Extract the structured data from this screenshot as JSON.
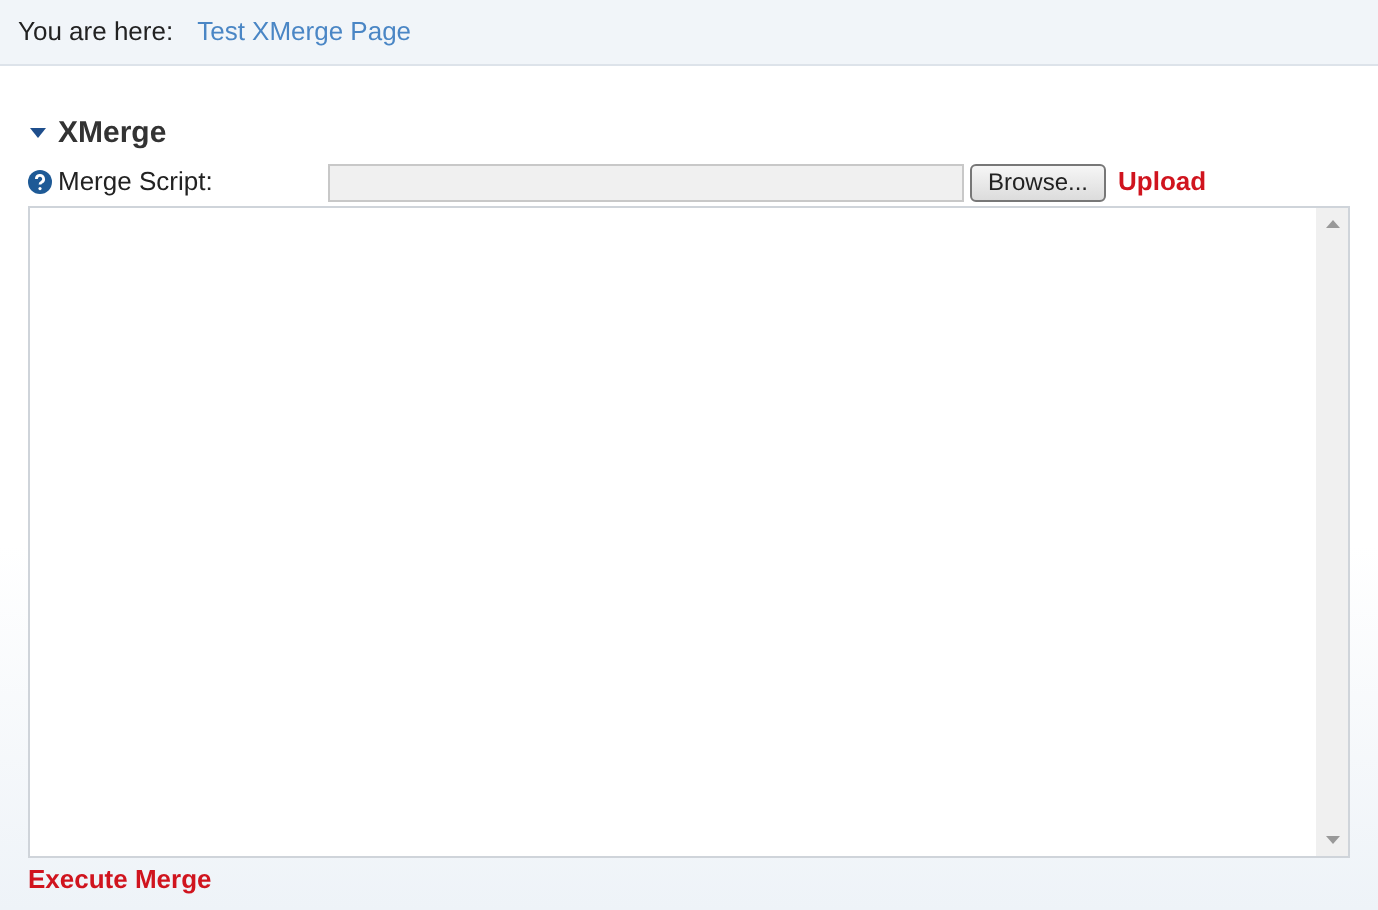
{
  "breadcrumb": {
    "label": "You are here:",
    "link": "Test XMerge Page"
  },
  "section": {
    "title": "XMerge",
    "expanded": true
  },
  "merge_script": {
    "label": "Merge Script:",
    "browse": "Browse...",
    "upload": "Upload"
  },
  "execute": "Execute Merge"
}
